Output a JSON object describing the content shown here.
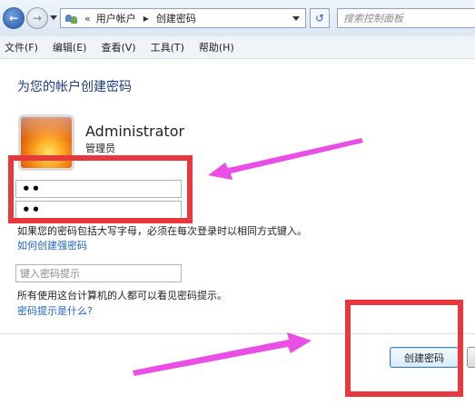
{
  "address_bar": {
    "crumbs": [
      "用户帐户",
      "创建密码"
    ],
    "overflow_chevron": "«",
    "search_placeholder": "搜索控制面板"
  },
  "menu": {
    "items": [
      "文件(F)",
      "编辑(E)",
      "查看(V)",
      "工具(T)",
      "帮助(H)"
    ]
  },
  "content": {
    "title": "为您的帐户创建密码",
    "user": {
      "name": "Administrator",
      "role": "管理员"
    },
    "password_mask": "••",
    "confirm_mask": "••",
    "case_note": "如果您的密码包括大写字母，必须在每次登录时以相同方式键入。",
    "strong_link": "如何创建强密码",
    "hint_placeholder": "键入密码提示",
    "hint_note": "所有使用这台计算机的人都可以看见密码提示。",
    "hint_link": "密码提示是什么?",
    "create_button": "创建密码"
  },
  "icons": [
    "back-arrow-icon",
    "forward-arrow-icon",
    "users-icon",
    "refresh-icon",
    "avatar-flower"
  ],
  "colors": {
    "title": "#1e3b84",
    "link": "#1e63c6",
    "annotation_box": "#e8383d",
    "annotation_arrow": "#e94fe5"
  }
}
